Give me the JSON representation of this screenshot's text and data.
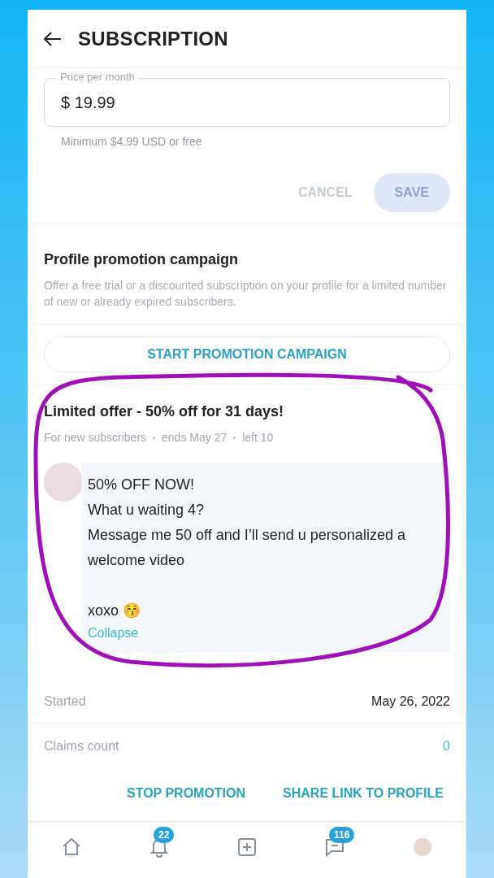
{
  "header": {
    "title": "SUBSCRIPTION"
  },
  "price": {
    "label": "Price per month",
    "value": "$ 19.99",
    "hint": "Minimum $4.99 USD or free"
  },
  "actions": [
    {
      "label": "CANCEL",
      "kind": "text",
      "disabled": true
    },
    {
      "label": "SAVE",
      "kind": "filled",
      "disabled": true
    }
  ],
  "promotion": {
    "title": "Profile promotion campaign",
    "description": "Offer a free trial or a discounted subscription on your profile for a limited number of new or already expired subscribers.",
    "button": "START PROMOTION CAMPAIGN"
  },
  "offer": {
    "title": "Limited offer - 50% off for 31 days!",
    "meta": [
      "For new subscribers",
      "ends May 27",
      "left 10"
    ],
    "message": "50% OFF NOW!\nWhat u waiting 4?\nMessage me 50 off and I’ll send u personalized a welcome video\n\nxoxo 😚",
    "toggle": "Collapse",
    "stats": [
      {
        "label": "Started",
        "value": "May 26, 2022",
        "kind": "plain"
      },
      {
        "label": "Claims count",
        "value": "0",
        "kind": "link"
      }
    ],
    "buttons": [
      "STOP PROMOTION",
      "SHARE LINK TO PROFILE"
    ]
  },
  "bottom_nav": {
    "notifications_badge": "22",
    "messages_badge": "116"
  }
}
